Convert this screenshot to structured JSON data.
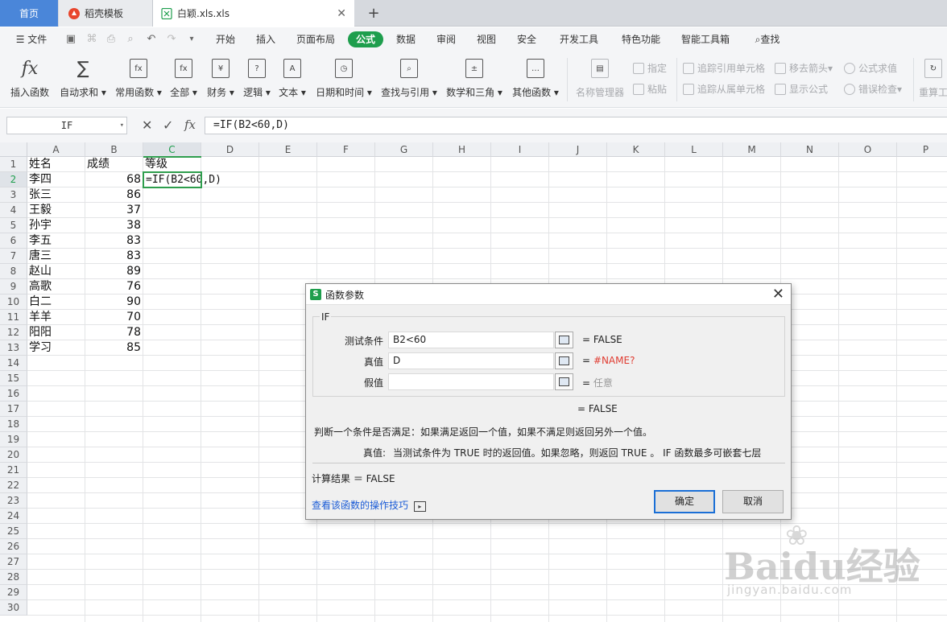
{
  "tabs": {
    "home": "首页",
    "templates": "稻壳模板",
    "file": "白颖.xls.xls"
  },
  "menu": {
    "file": "文件",
    "items": [
      "开始",
      "插入",
      "页面布局",
      "公式",
      "数据",
      "审阅",
      "视图",
      "安全",
      "开发工具",
      "特色功能",
      "智能工具箱"
    ],
    "active": "公式",
    "search": "查找"
  },
  "ribbon": {
    "insert_function": "插入函数",
    "autosum": "自动求和",
    "common": "常用函数",
    "all": "全部",
    "finance": "财务",
    "logic": "逻辑",
    "text": "文本",
    "datetime": "日期和时间",
    "lookup": "查找与引用",
    "math": "数学和三角",
    "other": "其他函数",
    "name_manager": "名称管理器",
    "define": "指定",
    "paste": "粘贴",
    "trace_precedents": "追踪引用单元格",
    "trace_dependents": "追踪从属单元格",
    "remove_arrows": "移去箭头",
    "show_formulas": "显示公式",
    "evaluate": "公式求值",
    "error_check": "错误检查",
    "recalc": "重算工"
  },
  "formula_bar": {
    "name_box": "IF",
    "formula": "=IF(B2<60,D)"
  },
  "sheet": {
    "columns": [
      "A",
      "B",
      "C",
      "D",
      "E",
      "F",
      "G",
      "H",
      "I",
      "J",
      "K",
      "L",
      "M",
      "N",
      "O",
      "P"
    ],
    "rows": [
      "1",
      "2",
      "3",
      "4",
      "5",
      "6",
      "7",
      "8",
      "9",
      "10",
      "11",
      "12",
      "13",
      "14",
      "15",
      "16",
      "17",
      "18",
      "19",
      "20",
      "21",
      "22",
      "23",
      "24",
      "25",
      "26",
      "27",
      "28",
      "29",
      "30"
    ],
    "headers": {
      "name": "姓名",
      "score": "成绩",
      "grade": "等级"
    },
    "editing_cell": "=IF(B2<60,D)",
    "data": [
      {
        "name": "李四",
        "score": "68"
      },
      {
        "name": "张三",
        "score": "86"
      },
      {
        "name": "王毅",
        "score": "37"
      },
      {
        "name": "孙宇",
        "score": "38"
      },
      {
        "name": "李五",
        "score": "83"
      },
      {
        "name": "唐三",
        "score": "83"
      },
      {
        "name": "赵山",
        "score": "89"
      },
      {
        "name": "高歌",
        "score": "76"
      },
      {
        "name": "白二",
        "score": "90"
      },
      {
        "name": "羊羊",
        "score": "70"
      },
      {
        "name": "阳阳",
        "score": "78"
      },
      {
        "name": "学习",
        "score": "85"
      }
    ]
  },
  "dialog": {
    "title": "函数参数",
    "function": "IF",
    "args": [
      {
        "label": "测试条件",
        "value": "B2<60",
        "result": "= FALSE"
      },
      {
        "label": "真值",
        "value": "D",
        "result_prefix": "=",
        "result": "#NAME?"
      },
      {
        "label": "假值",
        "value": "",
        "result_prefix": "=",
        "result": "任意"
      }
    ],
    "overall": "= FALSE",
    "description": "判断一个条件是否满足：如果满足返回一个值，如果不满足则返回另外一个值。",
    "param_name": "真值:",
    "param_desc": "当测试条件为 TRUE 时的返回值。如果忽略，则返回 TRUE 。 IF 函数最多可嵌套七层",
    "calc_result": "计算结果 ＝ FALSE",
    "help_link": "查看该函数的操作技巧",
    "ok": "确定",
    "cancel": "取消"
  },
  "watermark": {
    "brand": "Baidu经验",
    "url": "jingyan.baidu.com"
  },
  "colors": {
    "accent_green": "#1e9e4d",
    "home_tab": "#4a86d9",
    "error_red": "#e03c31",
    "link_blue": "#1a5bd6"
  }
}
